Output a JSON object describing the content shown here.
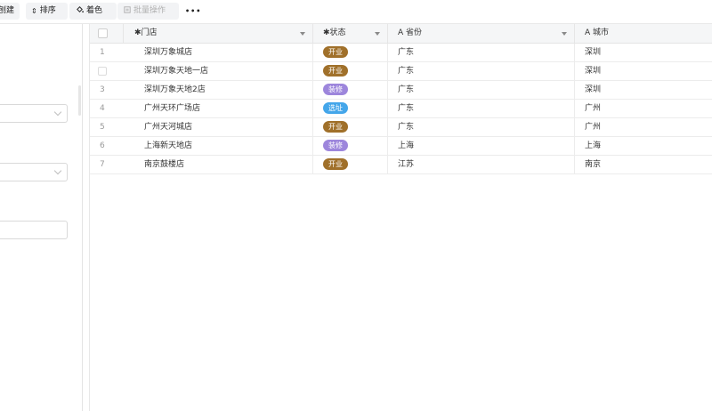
{
  "toolbar": {
    "buttons": [
      {
        "label": "刨建",
        "icon": "",
        "disabled": false
      },
      {
        "label": "排序",
        "icon": "sort-icon",
        "disabled": false
      },
      {
        "label": "着色",
        "icon": "paint-bucket-icon",
        "disabled": false
      },
      {
        "label": "批量操作",
        "icon": "batch-icon",
        "disabled": true
      },
      {
        "label": "•••",
        "icon": "more-icon",
        "disabled": false
      }
    ]
  },
  "grid": {
    "columns": [
      {
        "label": "✱门店",
        "type": "text"
      },
      {
        "label": "✱状态",
        "type": "select"
      },
      {
        "label": "A 省份",
        "type": "text"
      },
      {
        "label": "A 城市",
        "type": "text"
      }
    ],
    "rows": [
      {
        "num": "1",
        "store": "深圳万象城店",
        "status": "开业",
        "province": "广东",
        "city": "深圳"
      },
      {
        "num": "",
        "store": "深圳万象天地一店",
        "status": "开业",
        "province": "广东",
        "city": "深圳"
      },
      {
        "num": "3",
        "store": "深圳万象天地2店",
        "status": "装修",
        "province": "广东",
        "city": "深圳"
      },
      {
        "num": "4",
        "store": "广州天环广场店",
        "status": "选址",
        "province": "广东",
        "city": "广州"
      },
      {
        "num": "5",
        "store": "广州天河城店",
        "status": "开业",
        "province": "广东",
        "city": "广州"
      },
      {
        "num": "6",
        "store": "上海新天地店",
        "status": "装修",
        "province": "上海",
        "city": "上海"
      },
      {
        "num": "7",
        "store": "南京鼓楼店",
        "status": "开业",
        "province": "江苏",
        "city": "南京"
      }
    ]
  },
  "status_colors": {
    "开业": "#a0702a",
    "装修": "#9d86dc",
    "选址": "#44a6ea"
  }
}
